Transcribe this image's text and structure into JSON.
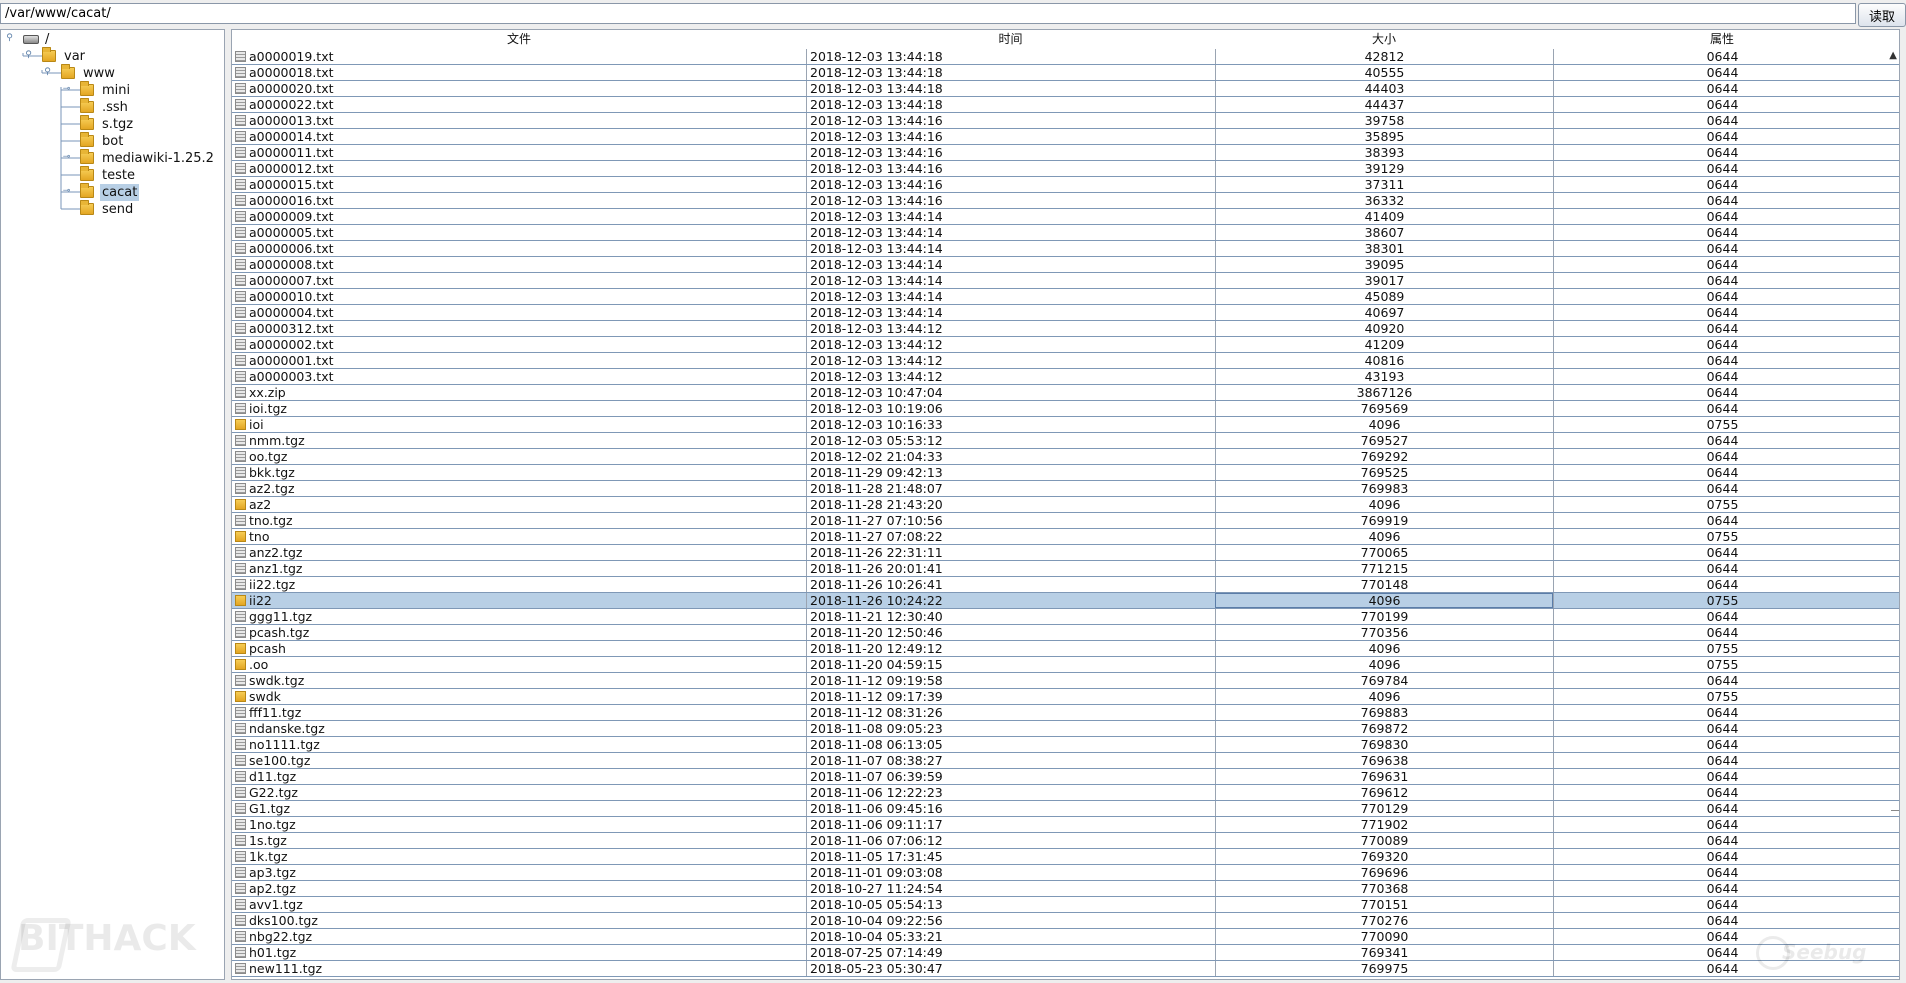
{
  "path_bar": {
    "value": "/var/www/cacat/"
  },
  "read_button": {
    "label": "读取"
  },
  "tree": [
    {
      "label": "/",
      "depth": 0,
      "type": "drive",
      "expanded": true,
      "selected": false
    },
    {
      "label": "var",
      "depth": 1,
      "type": "folder",
      "expanded": true,
      "selected": false
    },
    {
      "label": "www",
      "depth": 2,
      "type": "folder",
      "expanded": true,
      "selected": false
    },
    {
      "label": "mini",
      "depth": 3,
      "type": "folder",
      "expanded": false,
      "handle": true,
      "selected": false
    },
    {
      "label": ".ssh",
      "depth": 3,
      "type": "folder",
      "expanded": false,
      "handle": false,
      "selected": false
    },
    {
      "label": "s.tgz",
      "depth": 3,
      "type": "folder",
      "expanded": false,
      "handle": false,
      "selected": false
    },
    {
      "label": "bot",
      "depth": 3,
      "type": "folder",
      "expanded": false,
      "handle": false,
      "selected": false
    },
    {
      "label": "mediawiki-1.25.2",
      "depth": 3,
      "type": "folder",
      "expanded": false,
      "handle": true,
      "selected": false
    },
    {
      "label": "teste",
      "depth": 3,
      "type": "folder",
      "expanded": false,
      "handle": false,
      "selected": false
    },
    {
      "label": "cacat",
      "depth": 3,
      "type": "folder",
      "expanded": false,
      "handle": true,
      "selected": true
    },
    {
      "label": "send",
      "depth": 3,
      "type": "folder",
      "expanded": false,
      "handle": false,
      "selected": false
    }
  ],
  "table": {
    "columns": [
      "文件",
      "时间",
      "大小",
      "属性"
    ],
    "selected_index": 34,
    "rows": [
      {
        "type": "file",
        "name": "a0000019.txt",
        "time": "2018-12-03 13:44:18",
        "size": "42812",
        "attr": "0644"
      },
      {
        "type": "file",
        "name": "a0000018.txt",
        "time": "2018-12-03 13:44:18",
        "size": "40555",
        "attr": "0644"
      },
      {
        "type": "file",
        "name": "a0000020.txt",
        "time": "2018-12-03 13:44:18",
        "size": "44403",
        "attr": "0644"
      },
      {
        "type": "file",
        "name": "a0000022.txt",
        "time": "2018-12-03 13:44:18",
        "size": "44437",
        "attr": "0644"
      },
      {
        "type": "file",
        "name": "a0000013.txt",
        "time": "2018-12-03 13:44:16",
        "size": "39758",
        "attr": "0644"
      },
      {
        "type": "file",
        "name": "a0000014.txt",
        "time": "2018-12-03 13:44:16",
        "size": "35895",
        "attr": "0644"
      },
      {
        "type": "file",
        "name": "a0000011.txt",
        "time": "2018-12-03 13:44:16",
        "size": "38393",
        "attr": "0644"
      },
      {
        "type": "file",
        "name": "a0000012.txt",
        "time": "2018-12-03 13:44:16",
        "size": "39129",
        "attr": "0644"
      },
      {
        "type": "file",
        "name": "a0000015.txt",
        "time": "2018-12-03 13:44:16",
        "size": "37311",
        "attr": "0644"
      },
      {
        "type": "file",
        "name": "a0000016.txt",
        "time": "2018-12-03 13:44:16",
        "size": "36332",
        "attr": "0644"
      },
      {
        "type": "file",
        "name": "a0000009.txt",
        "time": "2018-12-03 13:44:14",
        "size": "41409",
        "attr": "0644"
      },
      {
        "type": "file",
        "name": "a0000005.txt",
        "time": "2018-12-03 13:44:14",
        "size": "38607",
        "attr": "0644"
      },
      {
        "type": "file",
        "name": "a0000006.txt",
        "time": "2018-12-03 13:44:14",
        "size": "38301",
        "attr": "0644"
      },
      {
        "type": "file",
        "name": "a0000008.txt",
        "time": "2018-12-03 13:44:14",
        "size": "39095",
        "attr": "0644"
      },
      {
        "type": "file",
        "name": "a0000007.txt",
        "time": "2018-12-03 13:44:14",
        "size": "39017",
        "attr": "0644"
      },
      {
        "type": "file",
        "name": "a0000010.txt",
        "time": "2018-12-03 13:44:14",
        "size": "45089",
        "attr": "0644"
      },
      {
        "type": "file",
        "name": "a0000004.txt",
        "time": "2018-12-03 13:44:14",
        "size": "40697",
        "attr": "0644"
      },
      {
        "type": "file",
        "name": "a0000312.txt",
        "time": "2018-12-03 13:44:12",
        "size": "40920",
        "attr": "0644"
      },
      {
        "type": "file",
        "name": "a0000002.txt",
        "time": "2018-12-03 13:44:12",
        "size": "41209",
        "attr": "0644"
      },
      {
        "type": "file",
        "name": "a0000001.txt",
        "time": "2018-12-03 13:44:12",
        "size": "40816",
        "attr": "0644"
      },
      {
        "type": "file",
        "name": "a0000003.txt",
        "time": "2018-12-03 13:44:12",
        "size": "43193",
        "attr": "0644"
      },
      {
        "type": "file",
        "name": "xx.zip",
        "time": "2018-12-03 10:47:04",
        "size": "3867126",
        "attr": "0644"
      },
      {
        "type": "file",
        "name": "ioi.tgz",
        "time": "2018-12-03 10:19:06",
        "size": "769569",
        "attr": "0644"
      },
      {
        "type": "dir",
        "name": "ioi",
        "time": "2018-12-03 10:16:33",
        "size": "4096",
        "attr": "0755"
      },
      {
        "type": "file",
        "name": "nmm.tgz",
        "time": "2018-12-03 05:53:12",
        "size": "769527",
        "attr": "0644"
      },
      {
        "type": "file",
        "name": "oo.tgz",
        "time": "2018-12-02 21:04:33",
        "size": "769292",
        "attr": "0644"
      },
      {
        "type": "file",
        "name": "bkk.tgz",
        "time": "2018-11-29 09:42:13",
        "size": "769525",
        "attr": "0644"
      },
      {
        "type": "file",
        "name": "az2.tgz",
        "time": "2018-11-28 21:48:07",
        "size": "769983",
        "attr": "0644"
      },
      {
        "type": "dir",
        "name": "az2",
        "time": "2018-11-28 21:43:20",
        "size": "4096",
        "attr": "0755"
      },
      {
        "type": "file",
        "name": "tno.tgz",
        "time": "2018-11-27 07:10:56",
        "size": "769919",
        "attr": "0644"
      },
      {
        "type": "dir",
        "name": "tno",
        "time": "2018-11-27 07:08:22",
        "size": "4096",
        "attr": "0755"
      },
      {
        "type": "file",
        "name": "anz2.tgz",
        "time": "2018-11-26 22:31:11",
        "size": "770065",
        "attr": "0644"
      },
      {
        "type": "file",
        "name": "anz1.tgz",
        "time": "2018-11-26 20:01:41",
        "size": "771215",
        "attr": "0644"
      },
      {
        "type": "file",
        "name": "ii22.tgz",
        "time": "2018-11-26 10:26:41",
        "size": "770148",
        "attr": "0644"
      },
      {
        "type": "dir",
        "name": "ii22",
        "time": "2018-11-26 10:24:22",
        "size": "4096",
        "attr": "0755"
      },
      {
        "type": "file",
        "name": "ggg11.tgz",
        "time": "2018-11-21 12:30:40",
        "size": "770199",
        "attr": "0644"
      },
      {
        "type": "file",
        "name": "pcash.tgz",
        "time": "2018-11-20 12:50:46",
        "size": "770356",
        "attr": "0644"
      },
      {
        "type": "dir",
        "name": "pcash",
        "time": "2018-11-20 12:49:12",
        "size": "4096",
        "attr": "0755"
      },
      {
        "type": "dir",
        "name": ".oo",
        "time": "2018-11-20 04:59:15",
        "size": "4096",
        "attr": "0755"
      },
      {
        "type": "file",
        "name": "swdk.tgz",
        "time": "2018-11-12 09:19:58",
        "size": "769784",
        "attr": "0644"
      },
      {
        "type": "dir",
        "name": "swdk",
        "time": "2018-11-12 09:17:39",
        "size": "4096",
        "attr": "0755"
      },
      {
        "type": "file",
        "name": "fff11.tgz",
        "time": "2018-11-12 08:31:26",
        "size": "769883",
        "attr": "0644"
      },
      {
        "type": "file",
        "name": "ndanske.tgz",
        "time": "2018-11-08 09:05:23",
        "size": "769872",
        "attr": "0644"
      },
      {
        "type": "file",
        "name": "no1111.tgz",
        "time": "2018-11-08 06:13:05",
        "size": "769830",
        "attr": "0644"
      },
      {
        "type": "file",
        "name": "se100.tgz",
        "time": "2018-11-07 08:38:27",
        "size": "769638",
        "attr": "0644"
      },
      {
        "type": "file",
        "name": "d11.tgz",
        "time": "2018-11-07 06:39:59",
        "size": "769631",
        "attr": "0644"
      },
      {
        "type": "file",
        "name": "G22.tgz",
        "time": "2018-11-06 12:22:23",
        "size": "769612",
        "attr": "0644"
      },
      {
        "type": "file",
        "name": "G1.tgz",
        "time": "2018-11-06 09:45:16",
        "size": "770129",
        "attr": "0644"
      },
      {
        "type": "file",
        "name": "1no.tgz",
        "time": "2018-11-06 09:11:17",
        "size": "771902",
        "attr": "0644"
      },
      {
        "type": "file",
        "name": "1s.tgz",
        "time": "2018-11-06 07:06:12",
        "size": "770089",
        "attr": "0644"
      },
      {
        "type": "file",
        "name": "1k.tgz",
        "time": "2018-11-05 17:31:45",
        "size": "769320",
        "attr": "0644"
      },
      {
        "type": "file",
        "name": "ap3.tgz",
        "time": "2018-11-01 09:03:08",
        "size": "769696",
        "attr": "0644"
      },
      {
        "type": "file",
        "name": "ap2.tgz",
        "time": "2018-10-27 11:24:54",
        "size": "770368",
        "attr": "0644"
      },
      {
        "type": "file",
        "name": "avv1.tgz",
        "time": "2018-10-05 05:54:13",
        "size": "770151",
        "attr": "0644"
      },
      {
        "type": "file",
        "name": "dks100.tgz",
        "time": "2018-10-04 09:22:56",
        "size": "770276",
        "attr": "0644"
      },
      {
        "type": "file",
        "name": "nbg22.tgz",
        "time": "2018-10-04 05:33:21",
        "size": "770090",
        "attr": "0644"
      },
      {
        "type": "file",
        "name": "h01.tgz",
        "time": "2018-07-25 07:14:49",
        "size": "769341",
        "attr": "0644"
      },
      {
        "type": "file",
        "name": "new111.tgz",
        "time": "2018-05-23 05:30:47",
        "size": "769975",
        "attr": "0644"
      }
    ]
  },
  "watermarks": {
    "left": "BITHACK",
    "right": "Seebug"
  },
  "icons": {
    "file": "file-icon",
    "dir": "folder-icon",
    "drive": "drive-icon",
    "expand": "tree-handle-icon"
  }
}
